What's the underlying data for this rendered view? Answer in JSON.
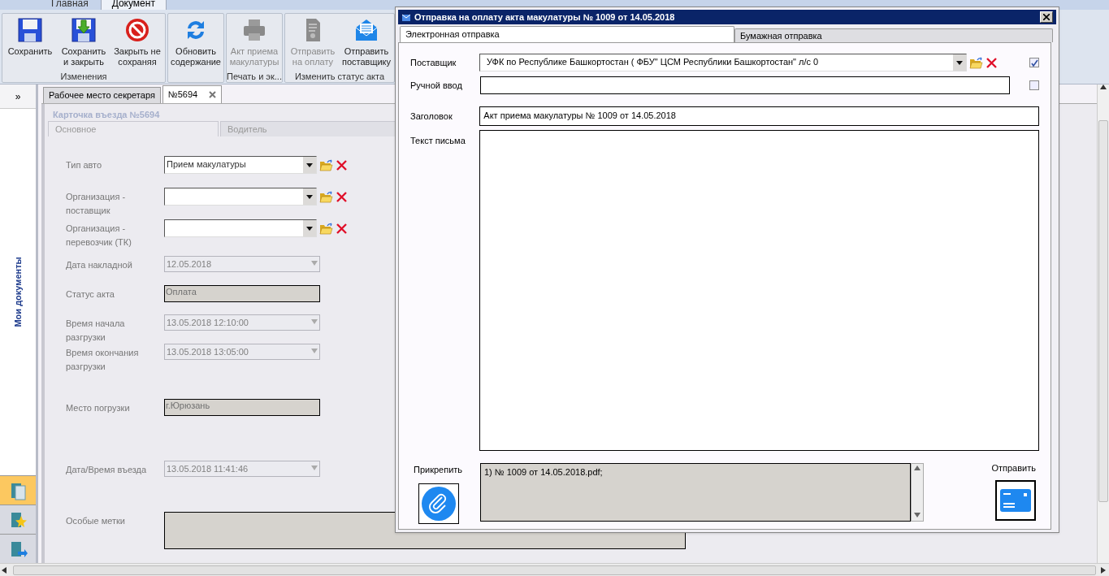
{
  "ribbon": {
    "tabs": [
      {
        "label": "Главная",
        "selected": false
      },
      {
        "label": "Документ",
        "selected": true
      }
    ],
    "groups": [
      {
        "label": "Изменения",
        "buttons": [
          {
            "label": "Сохранить",
            "disabled": false
          },
          {
            "label": "Сохранить\nи закрыть",
            "disabled": false
          },
          {
            "label": "Закрыть не\nсохраняя",
            "disabled": false
          }
        ]
      },
      {
        "buttons": [
          {
            "label": "Обновить\nсодержание",
            "disabled": false
          }
        ]
      },
      {
        "label": "Печать и эк...",
        "buttons": [
          {
            "label": "Акт приема\nмакулатуры",
            "disabled": true
          }
        ]
      },
      {
        "label": "Изменить статус акта",
        "buttons": [
          {
            "label": "Отправить\nна оплату",
            "disabled": true
          },
          {
            "label": "Отправить\nпоставщику",
            "disabled": false
          }
        ]
      }
    ]
  },
  "sidebar": {
    "expand": "»",
    "title": "Мои документы",
    "nav": [
      {
        "selected": true
      },
      {
        "selected": false
      },
      {
        "selected": false
      }
    ]
  },
  "doc_tabs": [
    {
      "label": "Рабочее место секретаря",
      "selected": false,
      "closable": false
    },
    {
      "label": "№5694",
      "selected": true,
      "closable": true
    }
  ],
  "card": {
    "title": "Карточка въезда №5694",
    "tabs": [
      {
        "label": "Основное",
        "selected": true
      },
      {
        "label": "Водитель",
        "selected": false
      }
    ],
    "fields": [
      {
        "kind": "lookup",
        "label": "Тип авто",
        "value": "Прием макулатуры"
      },
      {
        "kind": "lookup",
        "label": "Организация -\nпоставщик"
      },
      {
        "kind": "lookup",
        "label": "Организация -\nперевозчик (ТК)"
      },
      {
        "kind": "date",
        "label": "Дата накладной",
        "value": "12.05.2018",
        "disabled": true
      },
      {
        "kind": "text",
        "label": "Статус акта",
        "value": "Оплата"
      },
      {
        "kind": "date",
        "label": "Время начала\nразгрузки",
        "value": "13.05.2018 12:10:00",
        "disabled": true
      },
      {
        "kind": "date",
        "label": "Время окончания\nразгрузки",
        "value": "13.05.2018 13:05:00",
        "disabled": true
      },
      {
        "kind": "text",
        "label": "Место погрузки",
        "value": "г.Юрюзань"
      },
      {
        "kind": "date",
        "label": "Дата/Время въезда",
        "value": "13.05.2018 11:41:46",
        "disabled": true
      },
      {
        "kind": "memo",
        "label": "Особые метки"
      }
    ]
  },
  "dialog": {
    "title": "Отправка на оплату акта макулатуры  № 1009 от 14.05.2018",
    "tabs": [
      {
        "label": "Электронная отправка",
        "selected": true
      },
      {
        "label": "Бумажная отправка",
        "selected": false
      }
    ],
    "supplier": {
      "label": "Поставщик",
      "value": "УФК по Республике Башкортостан ( ФБУ\" ЦСМ Республики Башкортостан\" л/с 0",
      "checked": true
    },
    "manual": {
      "label": "Ручной ввод",
      "checked": false
    },
    "subject": {
      "label": "Заголовок",
      "value": "Акт приема макулатуры № 1009 от 14.05.2018"
    },
    "body": {
      "label": "Текст письма"
    },
    "attach": {
      "label": "Прикрепить",
      "files": "1) № 1009 от 14.05.2018.pdf;"
    },
    "send": {
      "label": "Отправить"
    }
  }
}
